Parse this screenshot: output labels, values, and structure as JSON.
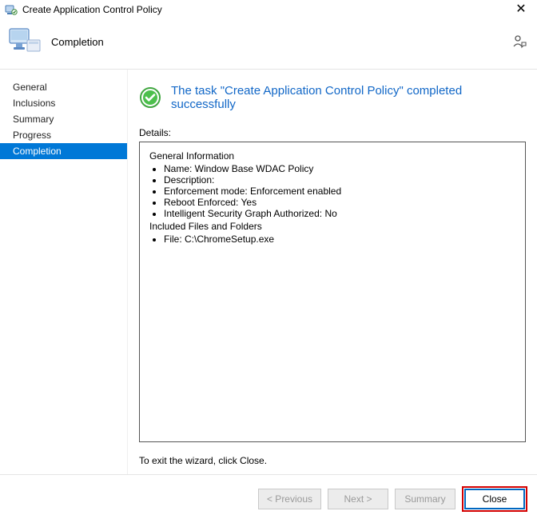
{
  "window": {
    "title": "Create Application Control Policy"
  },
  "header": {
    "page_title": "Completion"
  },
  "sidebar": {
    "items": [
      {
        "label": "General"
      },
      {
        "label": "Inclusions"
      },
      {
        "label": "Summary"
      },
      {
        "label": "Progress"
      },
      {
        "label": "Completion"
      }
    ],
    "selected_index": 4
  },
  "main": {
    "success_message": "The task \"Create Application Control Policy\" completed successfully",
    "details_label": "Details:",
    "details": {
      "section1_title": "General Information",
      "section1_items": {
        "name": "Name: Window Base WDAC Policy",
        "description": "Description:",
        "enforcement": "Enforcement mode: Enforcement enabled",
        "reboot": "Reboot Enforced: Yes",
        "isg": "Intelligent Security Graph Authorized: No"
      },
      "section2_title": "Included Files and Folders",
      "section2_items": {
        "file": "File: C:\\ChromeSetup.exe"
      }
    },
    "exit_note": "To exit the wizard, click Close."
  },
  "footer": {
    "previous": "< Previous",
    "next": "Next >",
    "summary": "Summary",
    "close": "Close"
  }
}
